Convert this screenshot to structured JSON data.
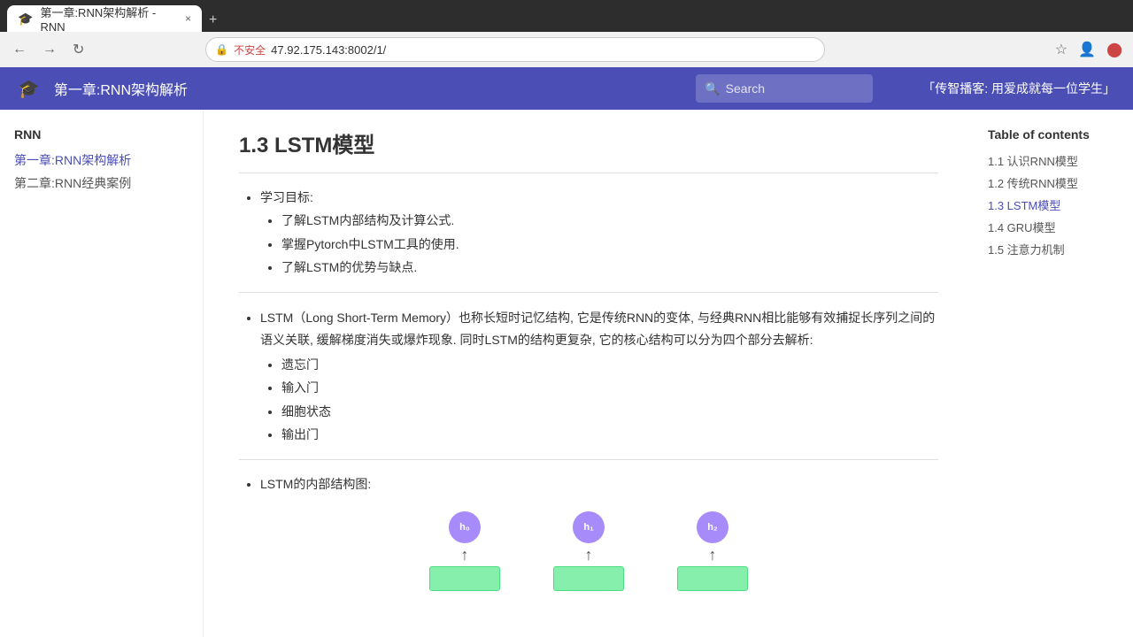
{
  "browser": {
    "tab_icon": "🎓",
    "tab_title": "第一章:RNN架构解析 - RNN",
    "tab_close": "×",
    "tab_new": "+",
    "back": "←",
    "forward": "→",
    "refresh": "↻",
    "lock_icon": "🔒",
    "address": "47.92.175.143:8002/1/",
    "star_icon": "☆",
    "security_label": "不安全"
  },
  "header": {
    "logo": "🎓",
    "title": "第一章:RNN架构解析",
    "search_placeholder": "Search",
    "brand_slogan": "「传智播客: 用爱成就每一位学生」"
  },
  "sidebar": {
    "section_title": "RNN",
    "links": [
      {
        "label": "第一章:RNN架构解析",
        "active": true
      },
      {
        "label": "第二章:RNN经典案例",
        "active": false
      }
    ]
  },
  "toc": {
    "title": "Table of contents",
    "items": [
      {
        "label": "1.1 认识RNN模型",
        "active": false
      },
      {
        "label": "1.2 传统RNN模型",
        "active": false
      },
      {
        "label": "1.3 LSTM模型",
        "active": true
      },
      {
        "label": "1.4 GRU模型",
        "active": false
      },
      {
        "label": "1.5 注意力机制",
        "active": false
      }
    ]
  },
  "main": {
    "heading": "1.3 LSTM模型",
    "section1_bullet": "学习目标:",
    "section1_subitems": [
      "了解LSTM内部结构及计算公式.",
      "掌握Pytorch中LSTM工具的使用.",
      "了解LSTM的优势与缺点."
    ],
    "section2_text": "LSTM（Long Short-Term Memory）也称长短时记忆结构, 它是传统RNN的变体, 与经典RNN相比能够有效捕捉长序列之间的语义关联, 缓解梯度消失或爆炸现象. 同时LSTM的结构更复杂, 它的核心结构可以分为四个部分去解析:",
    "section2_subitems": [
      "遗忘门",
      "输入门",
      "细胞状态",
      "输出门"
    ],
    "section3_bullet": "LSTM的内部结构图:",
    "diagram_nodes": [
      {
        "label": "h₀"
      },
      {
        "label": "h₁"
      },
      {
        "label": "h₂"
      }
    ]
  }
}
